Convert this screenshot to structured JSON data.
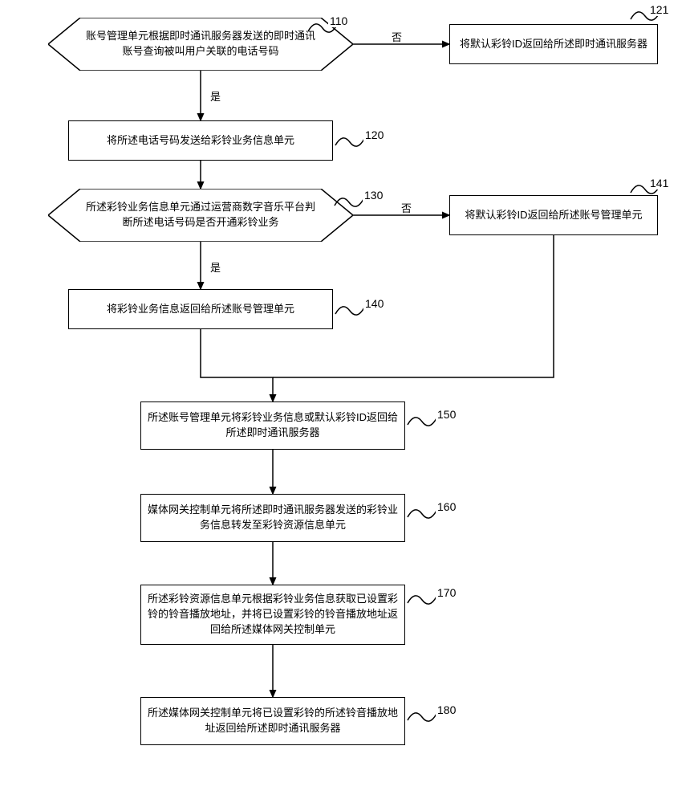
{
  "language": "zh-CN",
  "flow": {
    "nodes": {
      "d110": {
        "text": "账号管理单元根据即时通讯服务器发送的即时通讯账号查询被叫用户关联的电话号码",
        "label": "110",
        "yes": "是",
        "no": "否"
      },
      "b121": {
        "text": "将默认彩铃ID返回给所述即时通讯服务器",
        "label": "121"
      },
      "b120": {
        "text": "将所述电话号码发送给彩铃业务信息单元",
        "label": "120"
      },
      "d130": {
        "text": "所述彩铃业务信息单元通过运营商数字音乐平台判断所述电话号码是否开通彩铃业务",
        "label": "130",
        "yes": "是",
        "no": "否"
      },
      "b141": {
        "text": "将默认彩铃ID返回给所述账号管理单元",
        "label": "141"
      },
      "b140": {
        "text": "将彩铃业务信息返回给所述账号管理单元",
        "label": "140"
      },
      "b150": {
        "text": "所述账号管理单元将彩铃业务信息或默认彩铃ID返回给所述即时通讯服务器",
        "label": "150"
      },
      "b160": {
        "text": "媒体网关控制单元将所述即时通讯服务器发送的彩铃业务信息转发至彩铃资源信息单元",
        "label": "160"
      },
      "b170": {
        "text": "所述彩铃资源信息单元根据彩铃业务信息获取已设置彩铃的铃音播放地址，并将已设置彩铃的铃音播放地址返回给所述媒体网关控制单元",
        "label": "170"
      },
      "b180": {
        "text": "所述媒体网关控制单元将已设置彩铃的所述铃音播放地址返回给所述即时通讯服务器",
        "label": "180"
      }
    }
  }
}
